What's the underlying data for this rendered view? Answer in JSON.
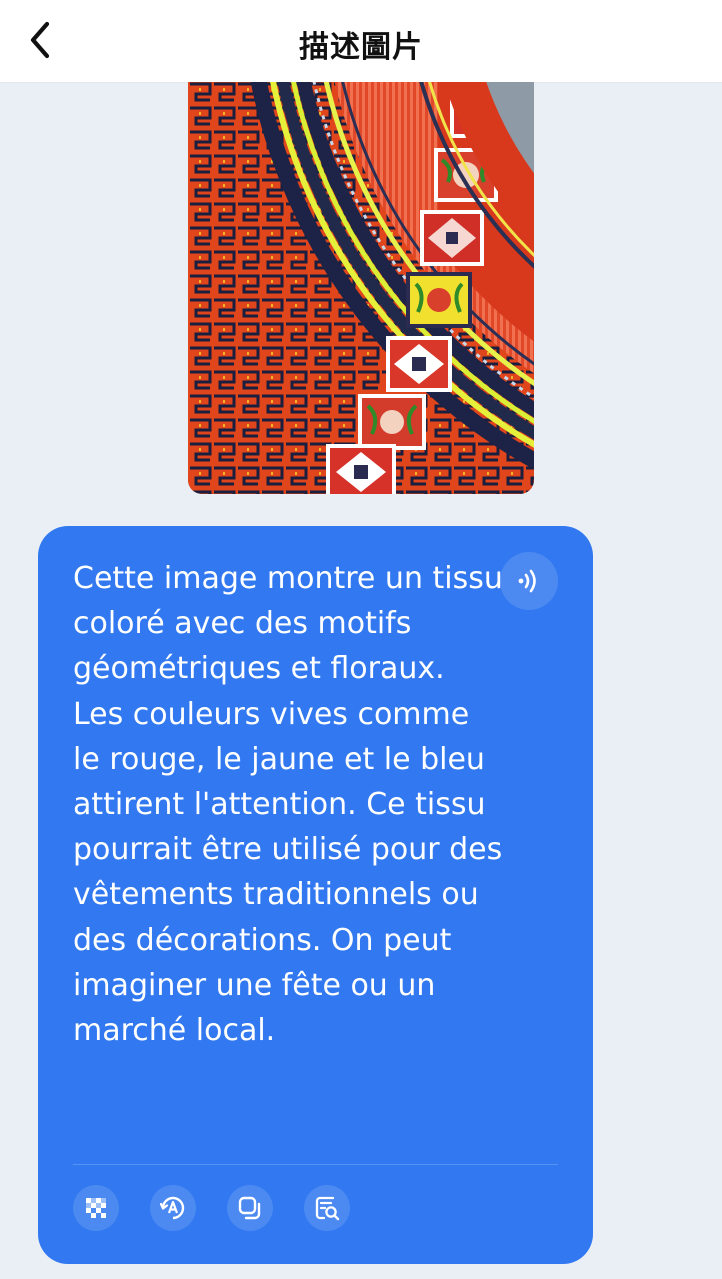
{
  "header": {
    "title": "描述圖片",
    "back_icon": "chevron-left-icon"
  },
  "photo": {
    "subject": "embroidered textile with geometric and floral motifs"
  },
  "message": {
    "text": "Cette image montre un tissu coloré avec des motifs géométriques et floraux. Les couleurs vives comme le rouge, le jaune et le bleu attirent l'attention. Ce tissu pourrait être utilisé pour des vêtements traditionnels ou des décorations. On peut imaginer une fête ou un marché local.",
    "speaker_icon": "speaker-icon"
  },
  "actions": [
    {
      "icon": "mosaic-icon"
    },
    {
      "icon": "translate-icon"
    },
    {
      "icon": "copy-icon"
    },
    {
      "icon": "search-text-icon"
    }
  ],
  "colors": {
    "bubble": "#3279f1",
    "background": "#eaeef5",
    "header": "#ffffff"
  }
}
